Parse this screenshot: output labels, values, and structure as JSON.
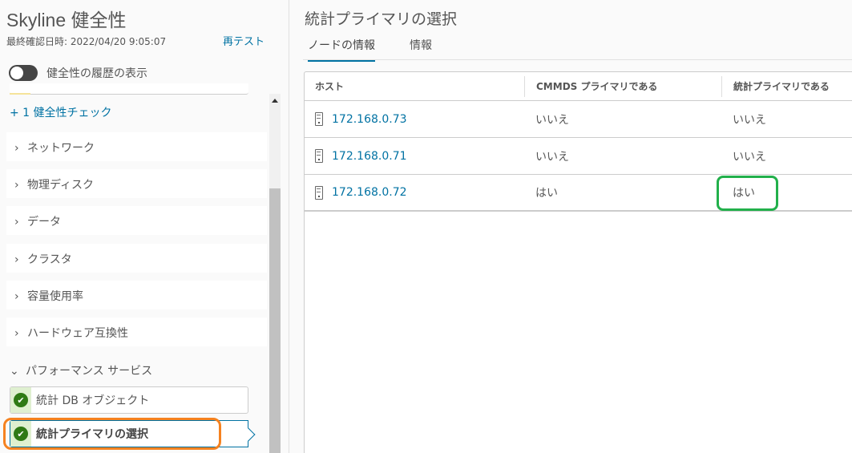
{
  "sidebar": {
    "title": "Skyline 健全性",
    "last_checked": "最終確認日時: 2022/04/20 9:05:07",
    "retest": "再テスト",
    "history_toggle_label": "健全性の履歴の表示",
    "history_toggle_on": false,
    "more_checks": "+ 1 健全性チェック",
    "categories": [
      "ネットワーク",
      "物理ディスク",
      "データ",
      "クラスタ",
      "容量使用率",
      "ハードウェア互換性"
    ],
    "expanded_category": "パフォーマンス サービス",
    "checks": [
      {
        "label": "統計 DB オブジェクト",
        "status": "ok"
      },
      {
        "label": "統計プライマリの選択",
        "status": "ok",
        "selected": true
      }
    ]
  },
  "main": {
    "title": "統計プライマリの選択",
    "tabs": [
      {
        "label": "ノードの情報",
        "active": true
      },
      {
        "label": "情報",
        "active": false
      }
    ],
    "table": {
      "columns": [
        "ホスト",
        "CMMDS プライマリである",
        "統計プライマリである"
      ],
      "rows": [
        [
          "172.168.0.73",
          "いいえ",
          "いいえ"
        ],
        [
          "172.168.0.71",
          "いいえ",
          "いいえ"
        ],
        [
          "172.168.0.72",
          "はい",
          "はい"
        ]
      ]
    }
  },
  "colors": {
    "link": "#0072a3",
    "ok": "#2f7a15",
    "highlight_orange": "#f58220",
    "highlight_green": "#22b04b"
  }
}
